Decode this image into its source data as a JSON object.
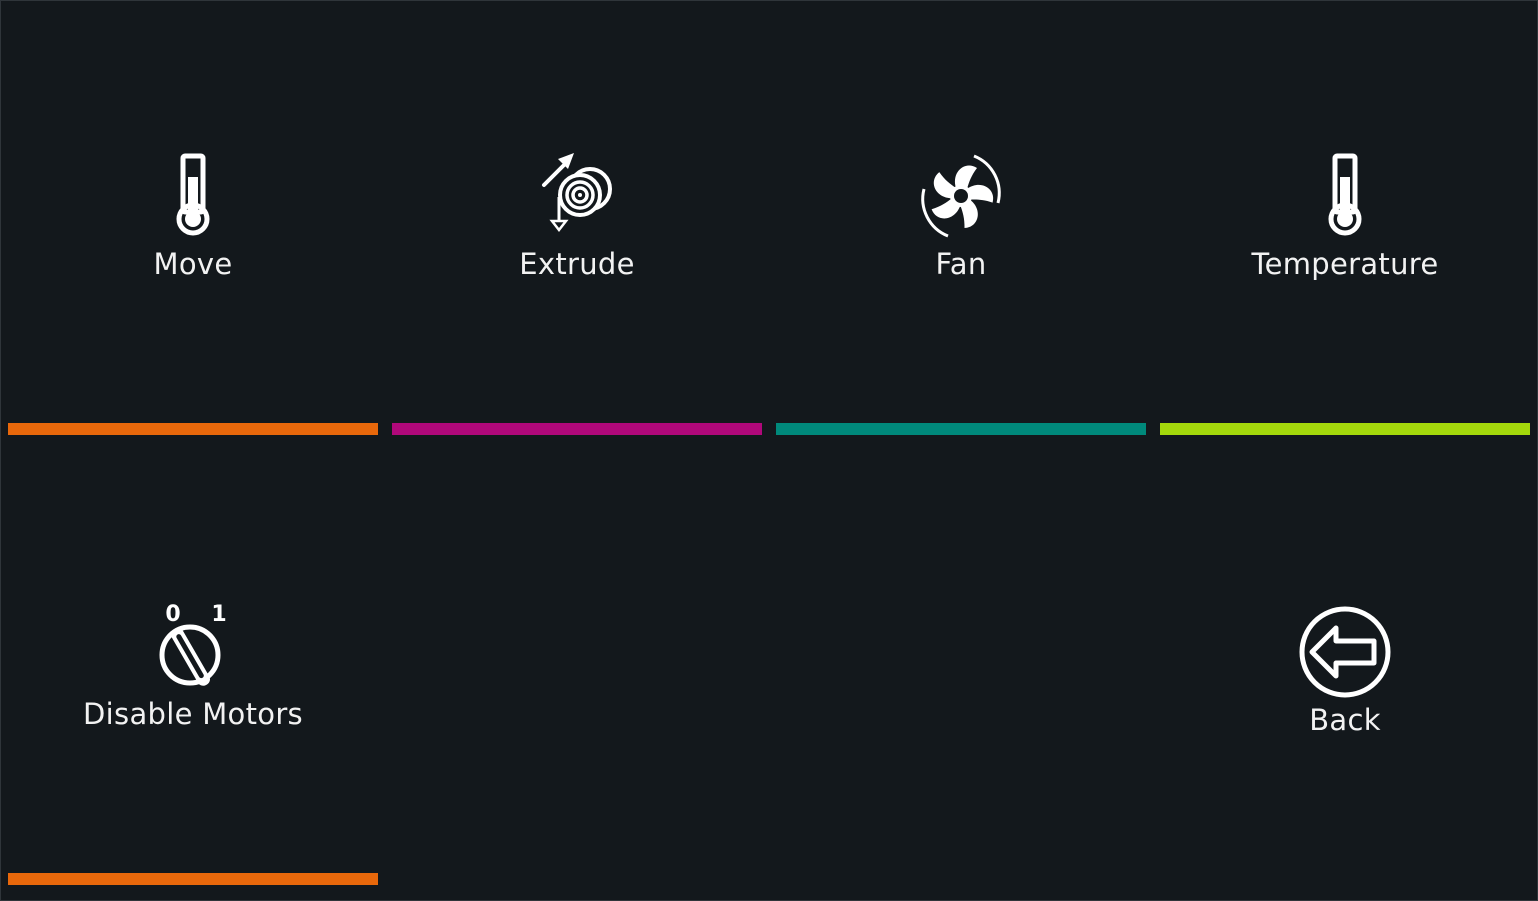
{
  "menu": {
    "items": [
      {
        "label": "Move",
        "icon": "thermometer-icon",
        "accent": "#e8680b"
      },
      {
        "label": "Extrude",
        "icon": "filament-spool-icon",
        "accent": "#b0087a"
      },
      {
        "label": "Fan",
        "icon": "fan-icon",
        "accent": "#00897b"
      },
      {
        "label": "Temperature",
        "icon": "thermometer-icon",
        "accent": "#a4d80c"
      },
      {
        "label": "Disable Motors",
        "icon": "motor-switch-icon",
        "accent": "#e8680b",
        "switch_off": "0",
        "switch_on": "1"
      }
    ],
    "back": {
      "label": "Back",
      "icon": "back-arrow-icon"
    }
  },
  "colors": {
    "background": "#13181c",
    "text": "#f2f2f2"
  }
}
